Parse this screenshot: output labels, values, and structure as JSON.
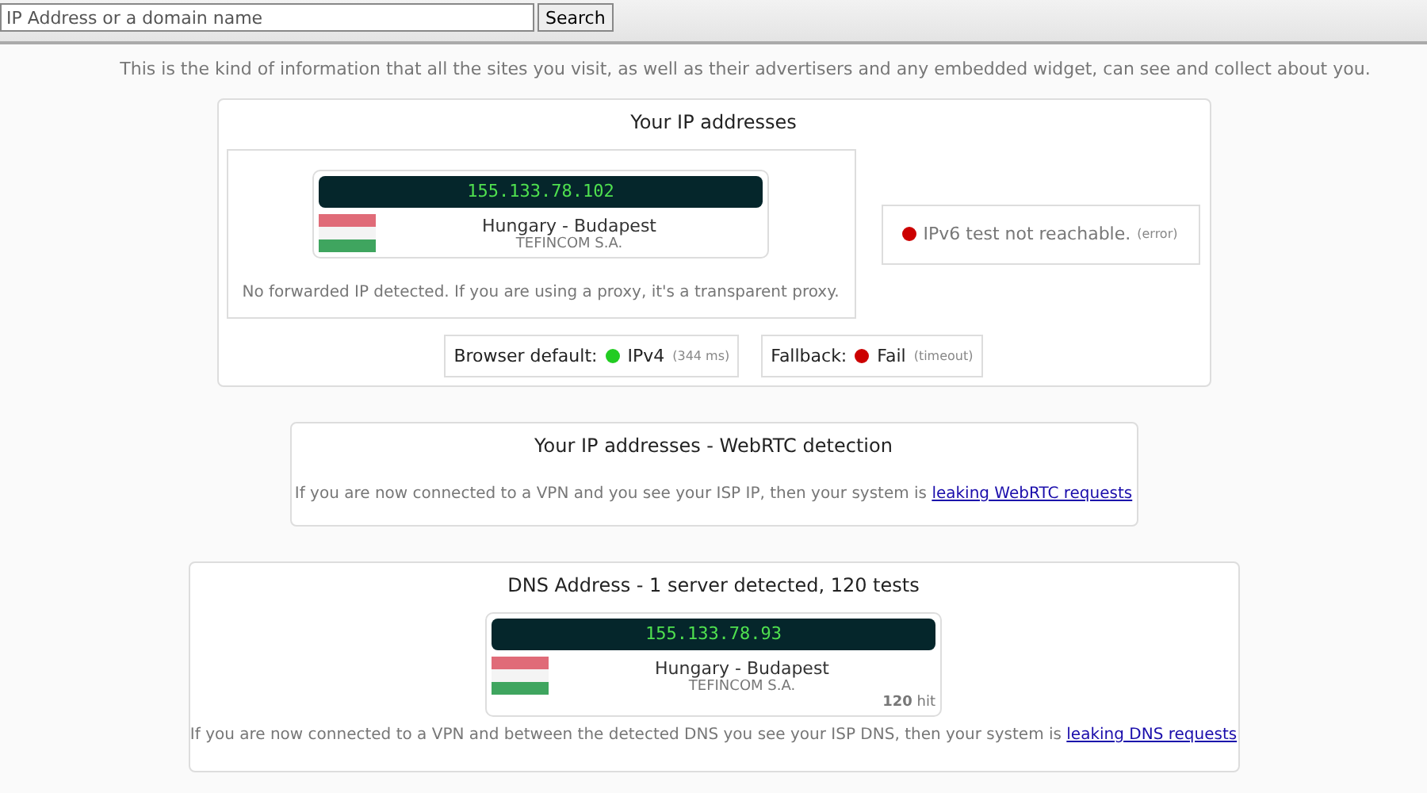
{
  "search": {
    "placeholder": "IP Address or a domain name",
    "button": "Search"
  },
  "intro": "This is the kind of information that all the sites you visit, as well as their advertisers and any embedded widget, can see and collect about you.",
  "ip_section": {
    "title": "Your IP addresses",
    "ip": {
      "address": "155.133.78.102",
      "location": "Hungary - Budapest",
      "isp": "TEFINCOM S.A."
    },
    "note": "No forwarded IP detected. If you are using a proxy, it's a transparent proxy.",
    "ipv6": {
      "color": "#cc0000",
      "text": "IPv6 test not reachable.",
      "detail": "(error)"
    },
    "tests": [
      {
        "label": "Browser default:",
        "color": "#22cc22",
        "value": "IPv4",
        "detail": "(344 ms)"
      },
      {
        "label": "Fallback:",
        "color": "#cc0000",
        "value": "Fail",
        "detail": "(timeout)"
      }
    ]
  },
  "webrtc_section": {
    "title": "Your IP addresses - WebRTC detection",
    "note": "If you are now connected to a VPN and you see your ISP IP, then your system is",
    "link": "leaking WebRTC requests"
  },
  "dns_section": {
    "title": "DNS Address - 1 server detected, 120 tests",
    "ip": {
      "address": "155.133.78.93",
      "location": "Hungary - Budapest",
      "isp": "TEFINCOM S.A.",
      "hits": "120",
      "hits_unit": "hit"
    },
    "note": "If you are now connected to a VPN and between the detected DNS you see your ISP DNS, then your system is",
    "link": "leaking DNS requests"
  }
}
